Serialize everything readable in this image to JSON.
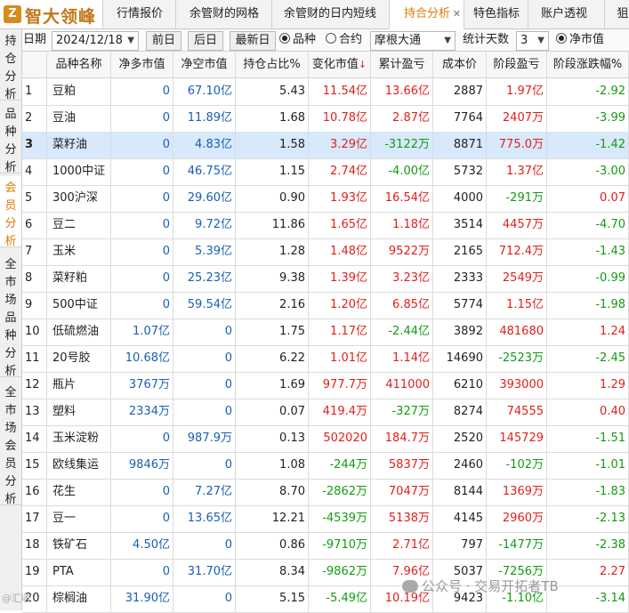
{
  "app": {
    "logo_text": "智大领峰",
    "logo_mark": "Z"
  },
  "tabs": [
    {
      "label": "行情报价",
      "active": false
    },
    {
      "label": "余管财的网格",
      "active": false
    },
    {
      "label": "余管财的日内短线",
      "active": false
    },
    {
      "label": "持合分析",
      "active": true,
      "close": "✕"
    },
    {
      "label": "特色指标",
      "active": false
    },
    {
      "label": "账户透视",
      "active": false
    },
    {
      "label": "狙",
      "active": false
    }
  ],
  "leftnav": [
    {
      "label": "持仓分析",
      "active": false
    },
    {
      "label": "品种分析",
      "active": false
    },
    {
      "label": "会员分析",
      "active": true
    },
    {
      "label": "全市场品种分析",
      "active": false
    },
    {
      "label": "全市场会员分析",
      "active": false
    }
  ],
  "toolbar": {
    "date_label": "日期",
    "date_value": "2024/12/18",
    "prev_day": "前日",
    "next_day": "后日",
    "latest_day": "最新日",
    "radio_variety": "品种",
    "radio_contract": "合约",
    "member_value": "摩根大通",
    "stat_days_label": "统计天数",
    "stat_days_value": "3",
    "radio_net_value": "净市值"
  },
  "colors": {
    "accent": "#e07a00",
    "red": "#e0201c",
    "green": "#139b13",
    "blue": "#1a5fb4",
    "selected_row": "#d7e9fb"
  },
  "table": {
    "headers": [
      "",
      "品种名称",
      "净多市值",
      "净空市值",
      "持仓占比%",
      "变化市值",
      "累计盈亏",
      "成本价",
      "阶段盈亏",
      "阶段涨跌幅%"
    ],
    "sort_indicator": "↓",
    "rows": [
      {
        "no": "1",
        "name": "豆粕",
        "long": "0",
        "short": "67.10亿",
        "pct": "5.43",
        "chg": "11.54亿",
        "cum": "13.66亿",
        "cost": "2887",
        "stage": "1.97亿",
        "stage_pct": "-2.92"
      },
      {
        "no": "2",
        "name": "豆油",
        "long": "0",
        "short": "11.89亿",
        "pct": "1.68",
        "chg": "10.78亿",
        "cum": "2.87亿",
        "cost": "7764",
        "stage": "2407万",
        "stage_pct": "-3.99"
      },
      {
        "no": "3",
        "name": "菜籽油",
        "long": "0",
        "short": "4.83亿",
        "pct": "1.58",
        "chg": "3.29亿",
        "cum": "-3122万",
        "cost": "8871",
        "stage": "775.0万",
        "stage_pct": "-1.42"
      },
      {
        "no": "4",
        "name": "1000中证",
        "long": "0",
        "short": "46.75亿",
        "pct": "1.15",
        "chg": "2.74亿",
        "cum": "-4.00亿",
        "cost": "5732",
        "stage": "1.37亿",
        "stage_pct": "-3.00"
      },
      {
        "no": "5",
        "name": "300沪深",
        "long": "0",
        "short": "29.60亿",
        "pct": "0.90",
        "chg": "1.93亿",
        "cum": "16.54亿",
        "cost": "4000",
        "stage": "-291万",
        "stage_pct": "0.07"
      },
      {
        "no": "6",
        "name": "豆二",
        "long": "0",
        "short": "9.72亿",
        "pct": "11.86",
        "chg": "1.65亿",
        "cum": "1.18亿",
        "cost": "3514",
        "stage": "4457万",
        "stage_pct": "-4.70"
      },
      {
        "no": "7",
        "name": "玉米",
        "long": "0",
        "short": "5.39亿",
        "pct": "1.28",
        "chg": "1.48亿",
        "cum": "9522万",
        "cost": "2165",
        "stage": "712.4万",
        "stage_pct": "-1.43"
      },
      {
        "no": "8",
        "name": "菜籽粕",
        "long": "0",
        "short": "25.23亿",
        "pct": "9.38",
        "chg": "1.39亿",
        "cum": "3.23亿",
        "cost": "2333",
        "stage": "2549万",
        "stage_pct": "-0.99"
      },
      {
        "no": "9",
        "name": "500中证",
        "long": "0",
        "short": "59.54亿",
        "pct": "2.16",
        "chg": "1.20亿",
        "cum": "6.85亿",
        "cost": "5774",
        "stage": "1.15亿",
        "stage_pct": "-1.98"
      },
      {
        "no": "10",
        "name": "低硫燃油",
        "long": "1.07亿",
        "short": "0",
        "pct": "1.75",
        "chg": "1.17亿",
        "cum": "-2.44亿",
        "cost": "3892",
        "stage": "481680",
        "stage_pct": "1.24"
      },
      {
        "no": "11",
        "name": "20号胶",
        "long": "10.68亿",
        "short": "0",
        "pct": "6.22",
        "chg": "1.01亿",
        "cum": "1.14亿",
        "cost": "14690",
        "stage": "-2523万",
        "stage_pct": "-2.45"
      },
      {
        "no": "12",
        "name": "瓶片",
        "long": "3767万",
        "short": "0",
        "pct": "1.69",
        "chg": "977.7万",
        "cum": "411000",
        "cost": "6210",
        "stage": "393000",
        "stage_pct": "1.29"
      },
      {
        "no": "13",
        "name": "塑料",
        "long": "2334万",
        "short": "0",
        "pct": "0.07",
        "chg": "419.4万",
        "cum": "-327万",
        "cost": "8274",
        "stage": "74555",
        "stage_pct": "0.40"
      },
      {
        "no": "14",
        "name": "玉米淀粉",
        "long": "0",
        "short": "987.9万",
        "pct": "0.13",
        "chg": "502020",
        "cum": "184.7万",
        "cost": "2520",
        "stage": "145729",
        "stage_pct": "-1.51"
      },
      {
        "no": "15",
        "name": "欧线集运",
        "long": "9846万",
        "short": "0",
        "pct": "1.08",
        "chg": "-244万",
        "cum": "5837万",
        "cost": "2460",
        "stage": "-102万",
        "stage_pct": "-1.01"
      },
      {
        "no": "16",
        "name": "花生",
        "long": "0",
        "short": "7.27亿",
        "pct": "8.70",
        "chg": "-2862万",
        "cum": "7047万",
        "cost": "8144",
        "stage": "1369万",
        "stage_pct": "-1.83"
      },
      {
        "no": "17",
        "name": "豆一",
        "long": "0",
        "short": "13.65亿",
        "pct": "12.21",
        "chg": "-4539万",
        "cum": "5138万",
        "cost": "4145",
        "stage": "2960万",
        "stage_pct": "-2.13"
      },
      {
        "no": "18",
        "name": "铁矿石",
        "long": "4.50亿",
        "short": "0",
        "pct": "0.86",
        "chg": "-9710万",
        "cum": "2.71亿",
        "cost": "797",
        "stage": "-1477万",
        "stage_pct": "-2.38"
      },
      {
        "no": "19",
        "name": "PTA",
        "long": "0",
        "short": "31.70亿",
        "pct": "8.34",
        "chg": "-9862万",
        "cum": "7.96亿",
        "cost": "5037",
        "stage": "-7256万",
        "stage_pct": "2.27"
      },
      {
        "no": "20",
        "name": "棕榈油",
        "long": "31.90亿",
        "short": "0",
        "pct": "5.15",
        "chg": "-5.49亿",
        "cum": "10.19亿",
        "cost": "9423",
        "stage": "-1.10亿",
        "stage_pct": "-3.14"
      }
    ],
    "selected_row": 2
  },
  "watermark": {
    "text": "公众号 · 交易开拓者TB",
    "left_text": "@汇收"
  }
}
